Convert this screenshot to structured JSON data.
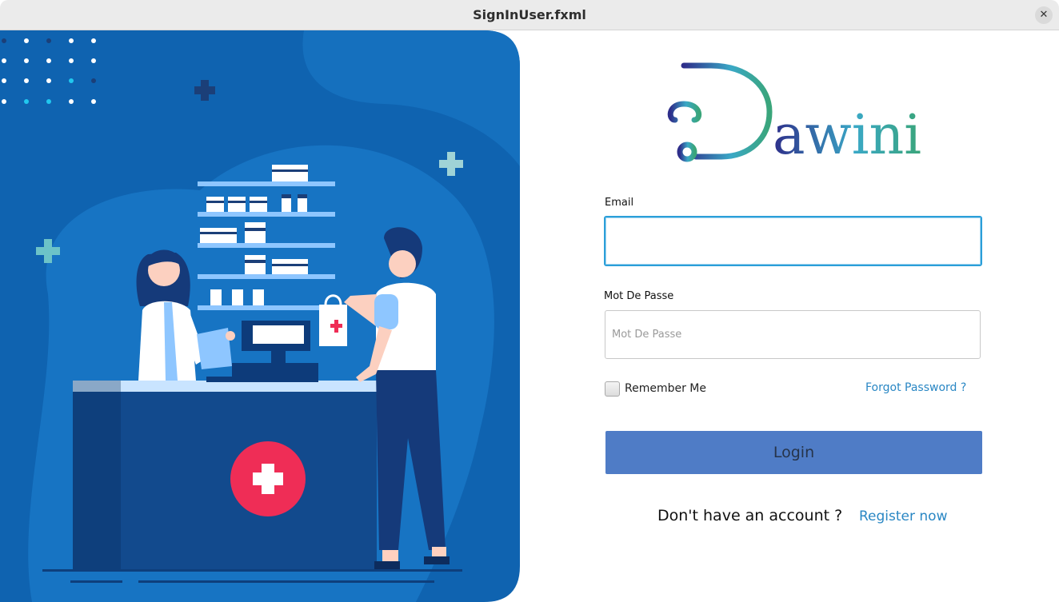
{
  "window": {
    "title": "SignInUser.fxml",
    "close_icon": "close-icon"
  },
  "brand": {
    "logo_text": "awini",
    "logo_icon": "stethoscope-d-icon"
  },
  "form": {
    "email_label": "Email",
    "email_value": "",
    "password_label": "Mot De Passe",
    "password_placeholder": "Mot De Passe",
    "remember_label": "Remember Me",
    "remember_checked": false,
    "forgot_label": "Forgot Password ?",
    "login_label": "Login",
    "no_account_text": "Don't have an account ?",
    "register_label": "Register now"
  },
  "colors": {
    "panel_blue": "#0f63b0",
    "button_blue": "#4f7cc6",
    "link_blue": "#2a87c4",
    "focus_border": "#2b9fd9",
    "cross_red": "#ef2d56"
  }
}
